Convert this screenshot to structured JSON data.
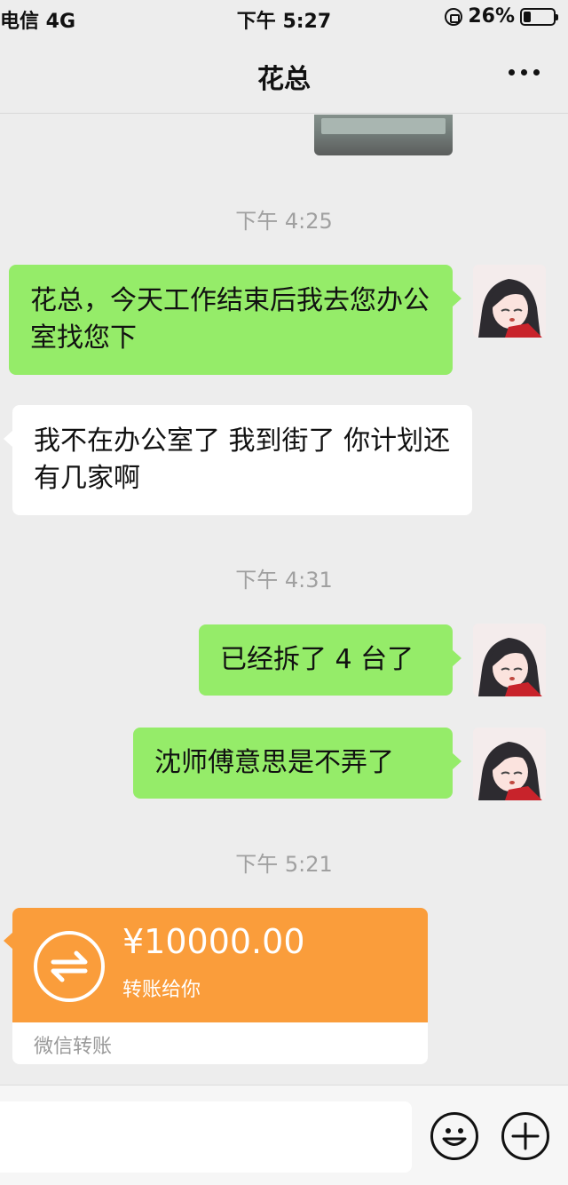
{
  "status_bar": {
    "carrier": "电信 4G",
    "time": "下午 5:27",
    "battery": "26%",
    "battery_level": 0.26
  },
  "nav": {
    "title": "花总",
    "more_icon": "more-dots-icon"
  },
  "chat": {
    "timestamps": [
      "下午 4:25",
      "下午 4:31",
      "下午 5:21"
    ],
    "messages": [
      {
        "from": "me",
        "text": "花总，今天工作结束后我去您办公室找您下"
      },
      {
        "from": "other",
        "text": "我不在办公室了 我到街了 你计划还有几家啊"
      },
      {
        "from": "me",
        "text": "已经拆了 4 台了"
      },
      {
        "from": "me",
        "text": "沈师傅意思是不弄了"
      }
    ],
    "transfer": {
      "amount": "¥10000.00",
      "note": "转账给你",
      "footer": "微信转账",
      "icon": "transfer-arrows-icon"
    }
  },
  "input_bar": {
    "emoji_icon": "emoji-icon",
    "plus_icon": "plus-icon"
  },
  "colors": {
    "sent_bubble": "#95ec69",
    "received_bubble": "#ffffff",
    "transfer_orange": "#fa9d3b",
    "background": "#ededed"
  }
}
